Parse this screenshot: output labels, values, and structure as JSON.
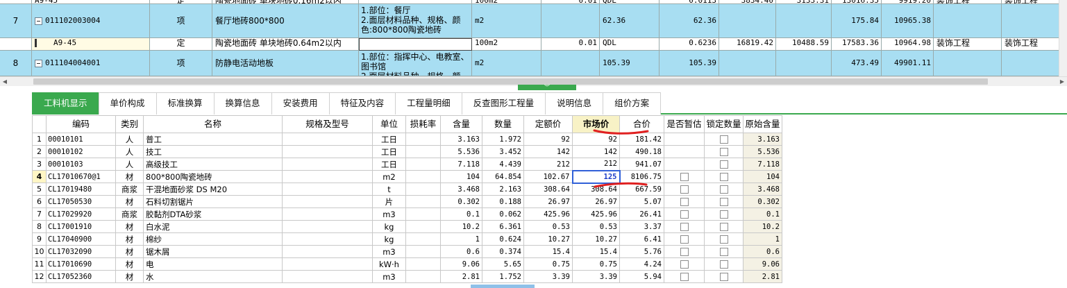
{
  "upper": {
    "partial_top_row": {
      "code": "A9-45",
      "type": "定",
      "name": "陶瓷地面砖 单块地砖0.16m2以内",
      "unit": "100m2",
      "quantity": "0.01",
      "qdl": "QDL",
      "col8": "0.0113",
      "col9": "3834.40",
      "col10": "3133.31",
      "col11": "13016.35",
      "col12": "9919.20",
      "col13": "装饰工程",
      "col14": "装饰工程"
    },
    "rows": [
      {
        "seq": "7",
        "code": "011102003004",
        "type": "项",
        "name": "餐厅地砖800*800",
        "features": "1.部位：餐厅\n2.面层材料品种、规格、颜色:800*800陶瓷地砖",
        "unit": "m2",
        "expr": "62.36",
        "quantity": "62.36",
        "unit_price": "175.84",
        "total": "10965.38"
      },
      {
        "seq": "",
        "code": "A9-45",
        "type": "定",
        "name": "陶瓷地面砖 单块地砖0.64m2以内",
        "features": "",
        "unit": "100m2",
        "expr": "0.01",
        "qdl": "QDL",
        "quantity": "0.6236",
        "col9": "16819.42",
        "col10": "10488.59",
        "unit_price": "17583.36",
        "total": "10964.98",
        "col13": "装饰工程",
        "col14": "装饰工程"
      },
      {
        "seq": "8",
        "code": "011104004001",
        "type": "项",
        "name": "防静电活动地板",
        "features": "1.部位：指挥中心、电教室、图书馆\n2.面层材料品种、规格、颜",
        "unit": "m2",
        "expr": "105.39",
        "quantity": "105.39",
        "unit_price": "473.49",
        "total": "49901.11"
      }
    ]
  },
  "tabs": [
    {
      "label": "工料机显示",
      "active": true
    },
    {
      "label": "单价构成"
    },
    {
      "label": "标准换算"
    },
    {
      "label": "换算信息"
    },
    {
      "label": "安装费用"
    },
    {
      "label": "特征及内容"
    },
    {
      "label": "工程量明细"
    },
    {
      "label": "反查图形工程量"
    },
    {
      "label": "说明信息"
    },
    {
      "label": "组价方案"
    }
  ],
  "lower": {
    "headers": {
      "code": "编码",
      "category": "类别",
      "name": "名称",
      "spec": "规格及型号",
      "unit": "单位",
      "loss": "损耗率",
      "content": "含量",
      "qty": "数量",
      "quota_price": "定额价",
      "market_price": "市场价",
      "sum": "合价",
      "provisional": "是否暂估",
      "lock_qty": "锁定数量",
      "orig_content": "原始含量"
    },
    "rows": [
      {
        "n": "1",
        "code": "00010101",
        "cat": "人",
        "name": "普工",
        "spec": "",
        "unit": "工日",
        "loss": "",
        "content": "3.163",
        "qty": "1.972",
        "quota": "92",
        "market": "92",
        "sum": "181.42",
        "prov": false,
        "lock": true,
        "orig": "3.163"
      },
      {
        "n": "2",
        "code": "00010102",
        "cat": "人",
        "name": "技工",
        "spec": "",
        "unit": "工日",
        "loss": "",
        "content": "5.536",
        "qty": "3.452",
        "quota": "142",
        "market": "142",
        "sum": "490.18",
        "prov": false,
        "lock": true,
        "orig": "5.536"
      },
      {
        "n": "3",
        "code": "00010103",
        "cat": "人",
        "name": "高级技工",
        "spec": "",
        "unit": "工日",
        "loss": "",
        "content": "7.118",
        "qty": "4.439",
        "quota": "212",
        "market": "212",
        "sum": "941.07",
        "prov": false,
        "lock": true,
        "orig": "7.118"
      },
      {
        "n": "4",
        "code": "CL17010670@1",
        "cat": "材",
        "name": "800*800陶瓷地砖",
        "spec": "",
        "unit": "m2",
        "loss": "",
        "content": "104",
        "qty": "64.854",
        "quota": "102.67",
        "market": "125",
        "sum": "8106.75",
        "prov": true,
        "lock": true,
        "orig": "104",
        "selected": true
      },
      {
        "n": "5",
        "code": "CL17019480",
        "cat": "商浆",
        "name": "干混地面砂浆 DS M20",
        "spec": "",
        "unit": "t",
        "loss": "",
        "content": "3.468",
        "qty": "2.163",
        "quota": "308.64",
        "market": "308.64",
        "sum": "667.59",
        "prov": true,
        "lock": true,
        "orig": "3.468"
      },
      {
        "n": "6",
        "code": "CL17050530",
        "cat": "材",
        "name": "石料切割锯片",
        "spec": "",
        "unit": "片",
        "loss": "",
        "content": "0.302",
        "qty": "0.188",
        "quota": "26.97",
        "market": "26.97",
        "sum": "5.07",
        "prov": true,
        "lock": true,
        "orig": "0.302"
      },
      {
        "n": "7",
        "code": "CL17029920",
        "cat": "商浆",
        "name": "胶黏剂DTA砂浆",
        "spec": "",
        "unit": "m3",
        "loss": "",
        "content": "0.1",
        "qty": "0.062",
        "quota": "425.96",
        "market": "425.96",
        "sum": "26.41",
        "prov": true,
        "lock": true,
        "orig": "0.1"
      },
      {
        "n": "8",
        "code": "CL17001910",
        "cat": "材",
        "name": "白水泥",
        "spec": "",
        "unit": "kg",
        "loss": "",
        "content": "10.2",
        "qty": "6.361",
        "quota": "0.53",
        "market": "0.53",
        "sum": "3.37",
        "prov": true,
        "lock": true,
        "orig": "10.2"
      },
      {
        "n": "9",
        "code": "CL17040900",
        "cat": "材",
        "name": "棉纱",
        "spec": "",
        "unit": "kg",
        "loss": "",
        "content": "1",
        "qty": "0.624",
        "quota": "10.27",
        "market": "10.27",
        "sum": "6.41",
        "prov": true,
        "lock": true,
        "orig": "1"
      },
      {
        "n": "10",
        "code": "CL17032090",
        "cat": "材",
        "name": "锯木屑",
        "spec": "",
        "unit": "m3",
        "loss": "",
        "content": "0.6",
        "qty": "0.374",
        "quota": "15.4",
        "market": "15.4",
        "sum": "5.76",
        "prov": true,
        "lock": true,
        "orig": "0.6"
      },
      {
        "n": "11",
        "code": "CL17010690",
        "cat": "材",
        "name": "电",
        "spec": "",
        "unit": "kW·h",
        "loss": "",
        "content": "9.06",
        "qty": "5.65",
        "quota": "0.75",
        "market": "0.75",
        "sum": "4.24",
        "prov": true,
        "lock": true,
        "orig": "9.06"
      },
      {
        "n": "12",
        "code": "CL17052360",
        "cat": "材",
        "name": "水",
        "spec": "",
        "unit": "m3",
        "loss": "",
        "content": "2.81",
        "qty": "1.752",
        "quota": "3.39",
        "market": "3.39",
        "sum": "5.94",
        "prov": true,
        "lock": true,
        "orig": "2.81"
      }
    ]
  },
  "colors": {
    "accent_green": "#3aa94e",
    "quota_row_blue": "#a8def2",
    "header_highlight": "#f8f2c6",
    "annotation_red": "#e02020",
    "edit_blue": "#1a3cc8"
  }
}
